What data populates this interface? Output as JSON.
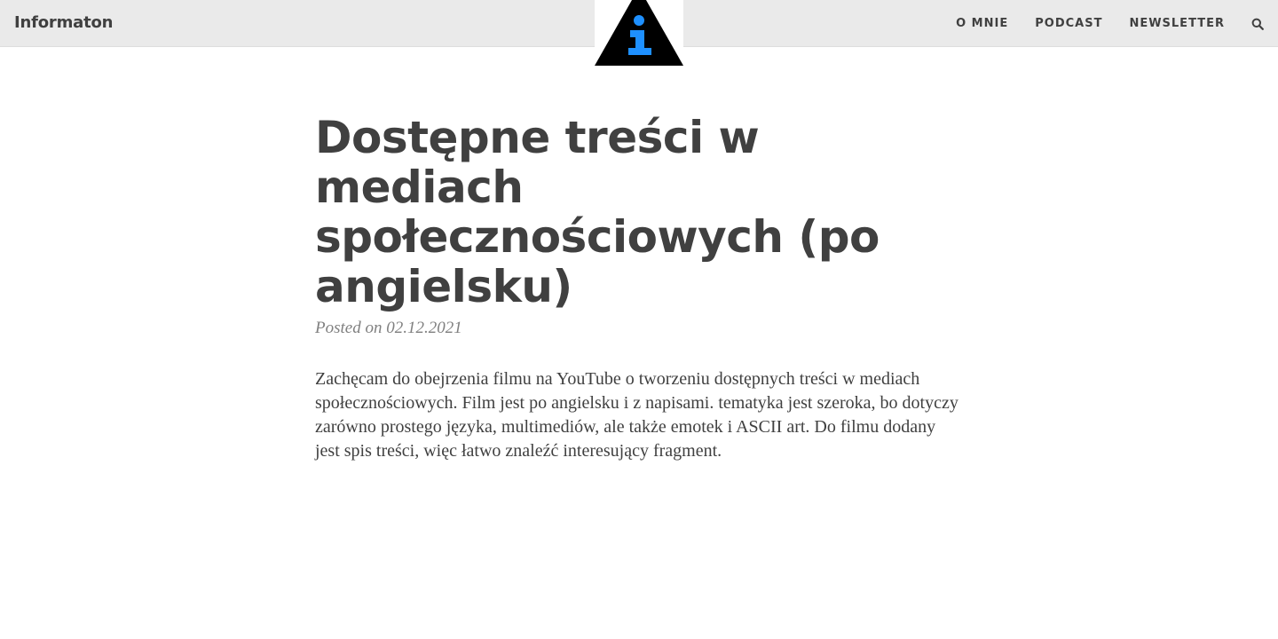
{
  "navbar": {
    "brand": "Informaton",
    "logo_icon": "info-triangle-icon",
    "links": [
      "O MNIE",
      "PODCAST",
      "NEWSLETTER"
    ],
    "search_icon": "search-icon"
  },
  "post": {
    "title": "Dostępne treści w mediach społecznościowych (po angielsku)",
    "meta": "Posted on 02.12.2021",
    "body": "Zachęcam do obejrzenia filmu na YouTube o tworzeniu dostępnych treści w mediach społecznościowych. Film jest po angielsku i z napisami. tematyka jest szeroka, bo dotyczy zarówno prostego języka, multimediów, ale także emotek i ASCII art. Do filmu dodany jest spis treści, więc łatwo znaleźć interesujący fragment."
  },
  "colors": {
    "navbar_bg": "#eaeaea",
    "text": "#404040",
    "meta": "#808080",
    "logo_accent": "#1e90ff"
  }
}
